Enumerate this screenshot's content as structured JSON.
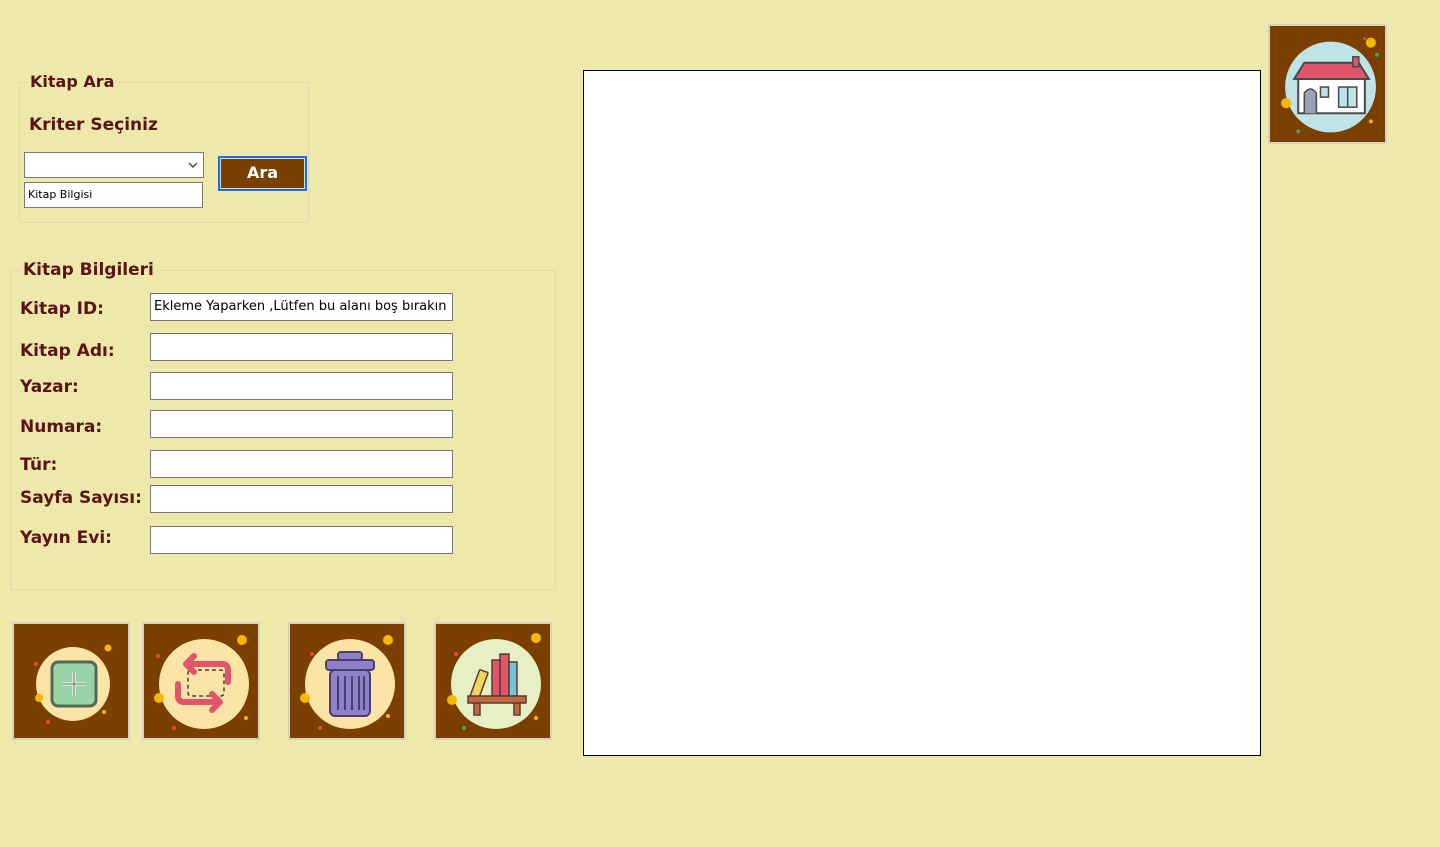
{
  "search_group": {
    "title": "Kitap Ara",
    "criteria_label": "Kriter Seçiniz",
    "criteria_selected": "",
    "query_placeholder": "Kitap Bilgisi",
    "search_button": "Ara"
  },
  "info_group": {
    "title": "Kitap Bilgileri",
    "fields": [
      {
        "label": "Kitap ID:",
        "value": "Ekleme Yaparken ,Lütfen bu alanı boş bırakın"
      },
      {
        "label": "Kitap Adı:",
        "value": ""
      },
      {
        "label": "Yazar:",
        "value": ""
      },
      {
        "label": "Numara:",
        "value": ""
      },
      {
        "label": "Tür:",
        "value": ""
      },
      {
        "label": "Sayfa Sayısı:",
        "value": ""
      },
      {
        "label": "Yayın Evi:",
        "value": ""
      }
    ]
  },
  "actions": [
    {
      "name": "add-book-button",
      "icon": "add-icon"
    },
    {
      "name": "update-book-button",
      "icon": "swap-arrows-icon"
    },
    {
      "name": "delete-book-button",
      "icon": "trash-can-icon"
    },
    {
      "name": "list-books-button",
      "icon": "bookshelf-icon"
    }
  ],
  "home_button": {
    "icon": "house-icon"
  },
  "colors": {
    "background": "#EEE8AA",
    "button_brown": "#7B3F00",
    "label_text": "#5A1414"
  }
}
